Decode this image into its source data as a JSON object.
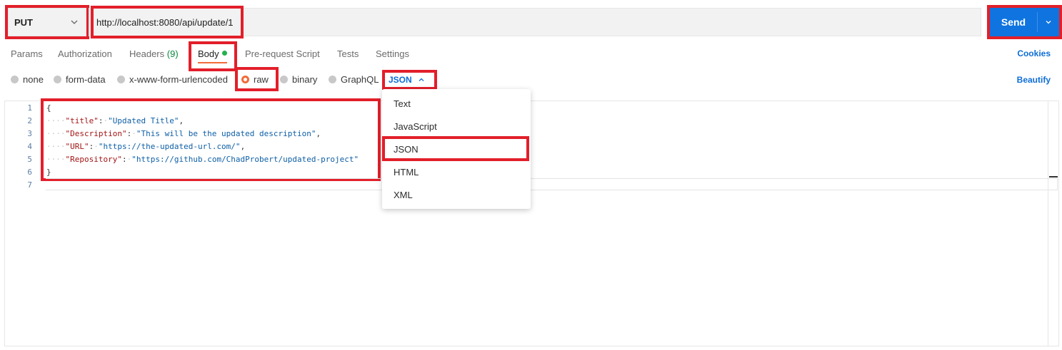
{
  "request": {
    "method": "PUT",
    "url": "http://localhost:8080/api/update/1",
    "send_label": "Send"
  },
  "tabs": {
    "params": "Params",
    "authorization": "Authorization",
    "headers": "Headers",
    "headers_count": "(9)",
    "body": "Body",
    "prerequest": "Pre-request Script",
    "tests": "Tests",
    "settings": "Settings",
    "cookies": "Cookies"
  },
  "body_types": {
    "none": "none",
    "form_data": "form-data",
    "urlencoded": "x-www-form-urlencoded",
    "raw": "raw",
    "binary": "binary",
    "graphql": "GraphQL",
    "selected_format": "JSON",
    "beautify": "Beautify"
  },
  "editor": {
    "line_numbers": [
      "1",
      "2",
      "3",
      "4",
      "5",
      "6",
      "7"
    ],
    "open_brace": "{",
    "close_brace": "}",
    "lines": [
      {
        "key": "\"title\"",
        "value": "\"Updated Title\"",
        "comma": ","
      },
      {
        "key": "\"Description\"",
        "value": "\"This will be the updated description\"",
        "comma": ","
      },
      {
        "key": "\"URL\"",
        "value": "\"https://the-updated-url.com/\"",
        "comma": ","
      },
      {
        "key": "\"Repository\"",
        "value": "\"https://github.com/ChadProbert/updated-project\"",
        "comma": ""
      }
    ]
  },
  "format_menu": {
    "items": [
      "Text",
      "JavaScript",
      "JSON",
      "HTML",
      "XML"
    ]
  },
  "colors": {
    "accent_blue": "#0f74e0",
    "highlight_red": "#e21f2a",
    "active_orange": "#f26b3a",
    "status_green": "#23b14d"
  }
}
